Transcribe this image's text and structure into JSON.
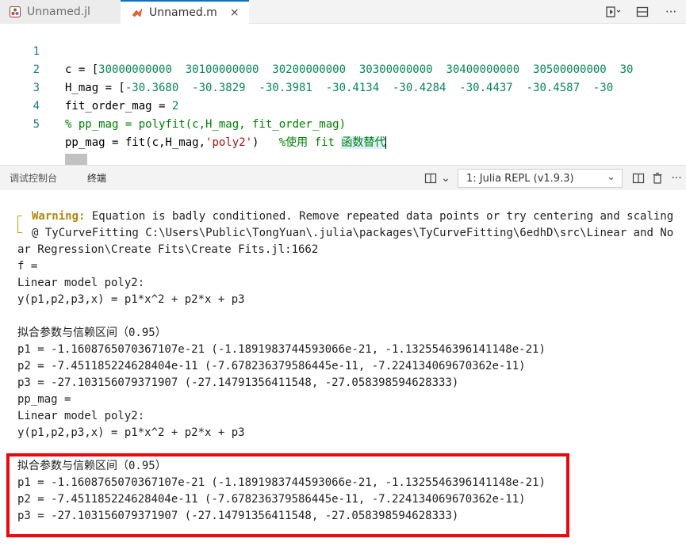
{
  "tabs": [
    {
      "label": "Unnamed.jl",
      "icon": "julia-file-icon",
      "active": false
    },
    {
      "label": "Unnamed.m",
      "icon": "matlab-file-icon",
      "active": true
    }
  ],
  "tab_close_glyph": "×",
  "editor": {
    "lines": [
      {
        "num": "1"
      },
      {
        "num": "2"
      },
      {
        "num": "3"
      },
      {
        "num": "4"
      },
      {
        "num": "5"
      }
    ],
    "l1": {
      "a": "c = [",
      "b": "30000000000  30100000000  30200000000  30300000000  30400000000  30500000000  30"
    },
    "l2": {
      "a": "H_mag = [",
      "b": "-30.3680  -30.3829  -30.3981  -30.4134  -30.4284  -30.4437  -30.4587  -30"
    },
    "l3": {
      "a": "fit_order_mag = ",
      "b": "2"
    },
    "l4": {
      "a": "% pp_mag = polyfit(c,H_mag, fit_order_mag)"
    },
    "l5": {
      "a": "pp_mag = fit(c,H_mag,",
      "b": "'poly2'",
      "c": ")   ",
      "d": "%使用 fit ",
      "e": "函数替代"
    }
  },
  "panel": {
    "tab_debug": "调试控制台",
    "tab_terminal": "终端",
    "terminal_select": "1: Julia REPL (v1.9.3)"
  },
  "terminal": {
    "warning_label": "Warning:",
    "warning_text": " Equation is badly conditioned. Remove repeated data points or try centering and scaling",
    "warning_loc": "@ TyCurveFitting C:\\Users\\Public\\TongYuan\\.julia\\packages\\TyCurveFitting\\6edhD\\src\\Linear and No",
    "warning_loc2": "ar Regression\\Create Fits\\Create Fits.jl:1662",
    "lines": [
      "f =",
      "Linear model poly2:",
      "y(p1,p2,p3,x) = p1*x^2 + p2*x + p3",
      "",
      "拟合参数与信赖区间（0.95）",
      "p1 = -1.1608765070367107e-21 (-1.1891983744593066e-21, -1.1325546396141148e-21)",
      "p2 = -7.451185224628404e-11 (-7.678236379586445e-11, -7.224134069670362e-11)",
      "p3 = -27.103156079371907 (-27.14791356411548, -27.058398594628333)",
      "pp_mag =",
      "Linear model poly2:",
      "y(p1,p2,p3,x) = p1*x^2 + p2*x + p3",
      "",
      "拟合参数与信赖区间（0.95）",
      "p1 = -1.1608765070367107e-21 (-1.1891983744593066e-21, -1.1325546396141148e-21)",
      "p2 = -7.451185224628404e-11 (-7.678236379586445e-11, -7.224134069670362e-11)",
      "p3 = -27.103156079371907 (-27.14791356411548, -27.058398594628333)"
    ]
  },
  "colors": {
    "accent": "#0e70c0",
    "highlight_box": "#e8090b",
    "warning": "#b5860b"
  }
}
